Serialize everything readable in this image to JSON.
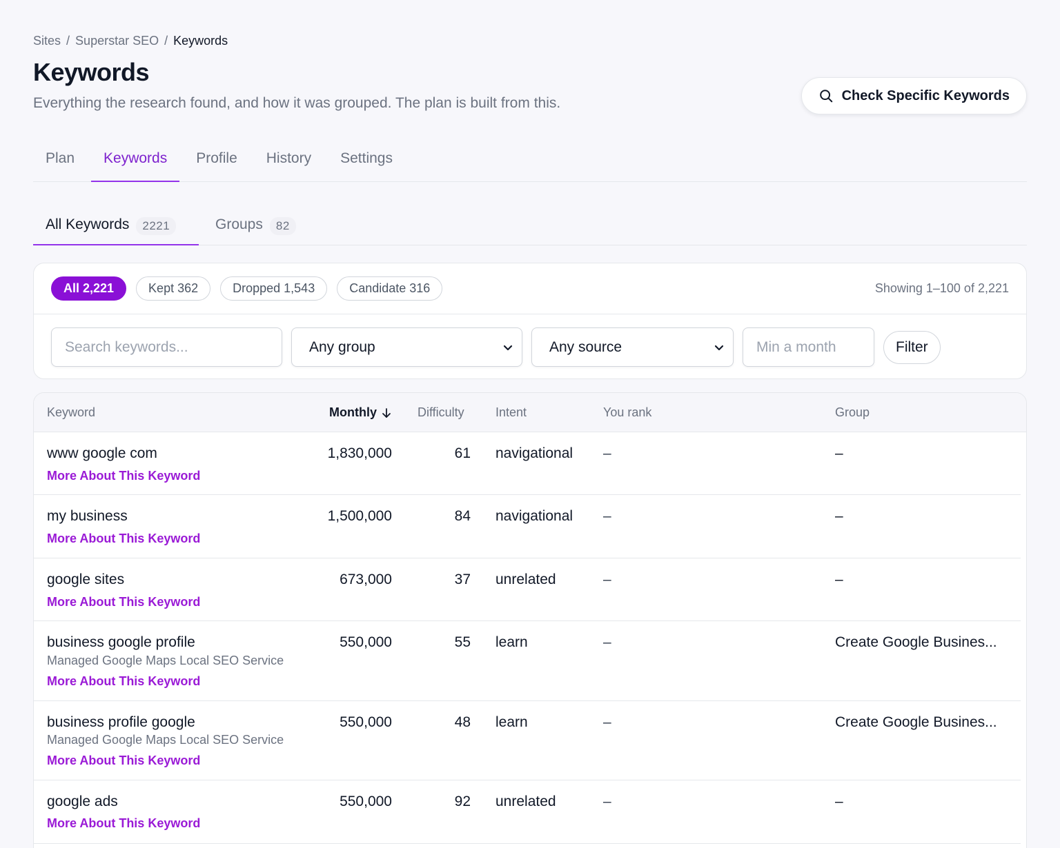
{
  "breadcrumb": {
    "items": [
      "Sites",
      "Superstar SEO",
      "Keywords"
    ],
    "separator": "/"
  },
  "header": {
    "title": "Keywords",
    "subtitle": "Everything the research found, and how it was grouped. The plan is built from this.",
    "check_button": "Check Specific Keywords"
  },
  "main_tabs": [
    {
      "label": "Plan"
    },
    {
      "label": "Keywords",
      "active": true
    },
    {
      "label": "Profile"
    },
    {
      "label": "History"
    },
    {
      "label": "Settings"
    }
  ],
  "sub_tabs": [
    {
      "label": "All Keywords",
      "count": "2221",
      "active": true
    },
    {
      "label": "Groups",
      "count": "82"
    }
  ],
  "filters": {
    "pills": [
      {
        "label": "All 2,221",
        "active": true
      },
      {
        "label": "Kept 362"
      },
      {
        "label": "Dropped 1,543"
      },
      {
        "label": "Candidate 316"
      }
    ],
    "showing": "Showing 1–100 of 2,221",
    "search_placeholder": "Search keywords...",
    "group_select": "Any group",
    "source_select": "Any source",
    "min_placeholder": "Min a month",
    "filter_button": "Filter"
  },
  "table": {
    "headers": {
      "keyword": "Keyword",
      "monthly": "Monthly",
      "difficulty": "Difficulty",
      "intent": "Intent",
      "rank": "You rank",
      "group": "Group"
    },
    "link_label": "More About This Keyword",
    "rows": [
      {
        "keyword": "www google com",
        "monthly": "1,830,000",
        "difficulty": "61",
        "intent": "navigational",
        "rank": "–",
        "group": "–"
      },
      {
        "keyword": "my business",
        "monthly": "1,500,000",
        "difficulty": "84",
        "intent": "navigational",
        "rank": "–",
        "group": "–"
      },
      {
        "keyword": "google sites",
        "monthly": "673,000",
        "difficulty": "37",
        "intent": "unrelated",
        "rank": "–",
        "group": "–"
      },
      {
        "keyword": "business google profile",
        "sub": "Managed Google Maps Local SEO Service",
        "monthly": "550,000",
        "difficulty": "55",
        "intent": "learn",
        "rank": "–",
        "group": "Create Google Busines..."
      },
      {
        "keyword": "business profile google",
        "sub": "Managed Google Maps Local SEO Service",
        "monthly": "550,000",
        "difficulty": "48",
        "intent": "learn",
        "rank": "–",
        "group": "Create Google Busines..."
      },
      {
        "keyword": "google ads",
        "monthly": "550,000",
        "difficulty": "92",
        "intent": "unrelated",
        "rank": "–",
        "group": "–"
      }
    ]
  },
  "colors": {
    "accent": "#8a10d6",
    "link": "#9a1ad6",
    "tab_active": "#7e22ce"
  }
}
